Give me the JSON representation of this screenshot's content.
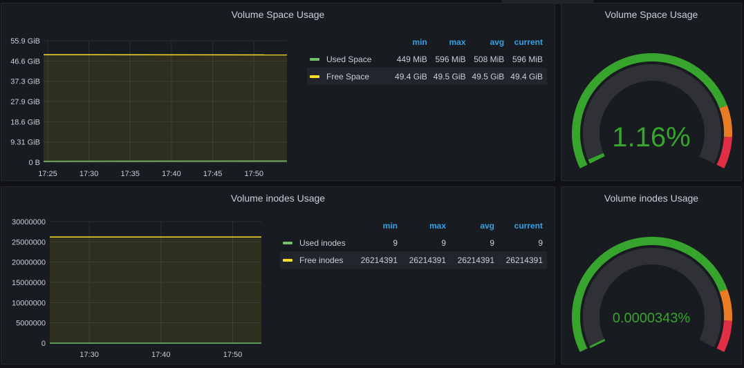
{
  "colors": {
    "background": "#111217",
    "panel": "#181b1f",
    "used_series": "#73bf69",
    "free_series": "#fade2a",
    "legend_header": "#33a2e5",
    "gauge_green": "#37a42d",
    "gauge_orange": "#e97b23",
    "gauge_red": "#e02f44",
    "gauge_track": "#2f3136"
  },
  "panels": {
    "space_graph": {
      "title": "Volume Space Usage",
      "legend": {
        "headers": [
          "min",
          "max",
          "avg",
          "current"
        ],
        "rows": [
          {
            "name": "Used Space",
            "min": "449 MiB",
            "max": "596 MiB",
            "avg": "508 MiB",
            "current": "596 MiB"
          },
          {
            "name": "Free Space",
            "min": "49.4 GiB",
            "max": "49.5 GiB",
            "avg": "49.5 GiB",
            "current": "49.4 GiB"
          }
        ]
      }
    },
    "space_gauge": {
      "title": "Volume Space Usage",
      "value": "1.16%",
      "percent": 1.16,
      "thresholds": {
        "orange": 80,
        "red": 90
      }
    },
    "inodes_graph": {
      "title": "Volume inodes Usage",
      "legend": {
        "headers": [
          "min",
          "max",
          "avg",
          "current"
        ],
        "rows": [
          {
            "name": "Used inodes",
            "min": "9",
            "max": "9",
            "avg": "9",
            "current": "9"
          },
          {
            "name": "Free inodes",
            "min": "26214391",
            "max": "26214391",
            "avg": "26214391",
            "current": "26214391"
          }
        ]
      }
    },
    "inodes_gauge": {
      "title": "Volume inodes Usage",
      "value": "0.0000343%",
      "percent": 3.43e-05,
      "thresholds": {
        "orange": 80,
        "red": 90
      }
    }
  },
  "chart_data": [
    {
      "type": "area",
      "x_ticks": [
        "17:25",
        "17:30",
        "17:35",
        "17:40",
        "17:45",
        "17:50"
      ],
      "y_ticks": [
        "0 B",
        "9.31 GiB",
        "18.6 GiB",
        "27.9 GiB",
        "37.3 GiB",
        "46.6 GiB",
        "55.9 GiB"
      ],
      "ylim": [
        0,
        55.9
      ],
      "y_unit": "GiB",
      "xlim": [
        "17:24:30",
        "17:54:00"
      ],
      "grid": true,
      "series": [
        {
          "name": "Used Space",
          "color": "#73bf69",
          "x": [
            "17:24:30",
            "17:54:00"
          ],
          "values": [
            0.45,
            0.58
          ]
        },
        {
          "name": "Free Space",
          "color": "#fade2a",
          "x": [
            "17:24:30",
            "17:54:00"
          ],
          "values": [
            49.5,
            49.4
          ]
        }
      ]
    },
    {
      "type": "area",
      "x_ticks": [
        "17:30",
        "17:40",
        "17:50"
      ],
      "y_ticks": [
        "0",
        "5000000",
        "10000000",
        "15000000",
        "20000000",
        "25000000",
        "30000000"
      ],
      "ylim": [
        0,
        30000000
      ],
      "xlim": [
        "17:24:30",
        "17:54:00"
      ],
      "grid": true,
      "series": [
        {
          "name": "Used inodes",
          "color": "#73bf69",
          "x": [
            "17:24:30",
            "17:54:00"
          ],
          "values": [
            9,
            9
          ]
        },
        {
          "name": "Free inodes",
          "color": "#fade2a",
          "x": [
            "17:24:30",
            "17:54:00"
          ],
          "values": [
            26214391,
            26214391
          ]
        }
      ]
    }
  ]
}
